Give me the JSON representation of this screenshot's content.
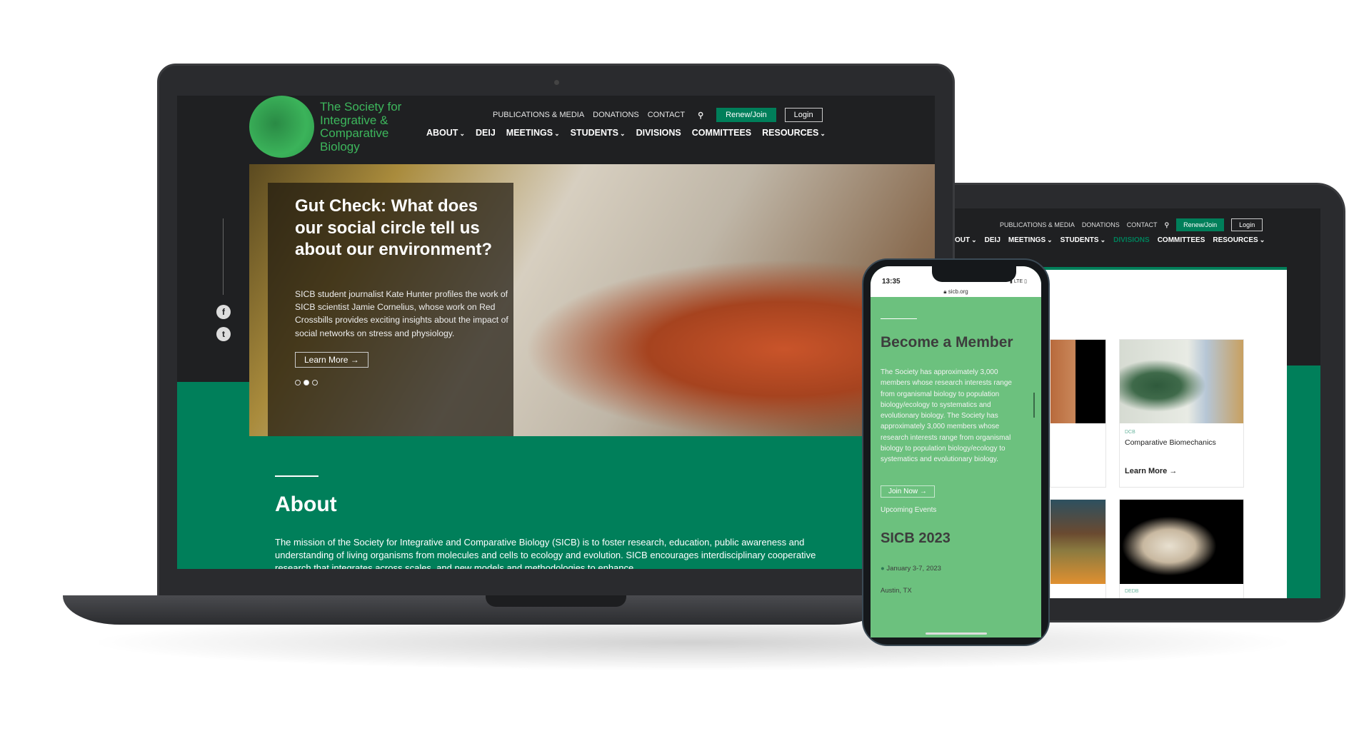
{
  "site": {
    "logo_text": "The Society for Integrative & Comparative Biology",
    "top_nav": [
      "PUBLICATIONS & MEDIA",
      "DONATIONS",
      "CONTACT"
    ],
    "search_icon": "search-icon",
    "renew_label": "Renew/Join",
    "login_label": "Login",
    "main_nav": [
      {
        "label": "ABOUT",
        "dropdown": true
      },
      {
        "label": "DEIJ",
        "dropdown": false
      },
      {
        "label": "MEETINGS",
        "dropdown": true
      },
      {
        "label": "STUDENTS",
        "dropdown": true
      },
      {
        "label": "DIVISIONS",
        "dropdown": false
      },
      {
        "label": "COMMITTEES",
        "dropdown": false
      },
      {
        "label": "RESOURCES",
        "dropdown": true
      }
    ],
    "colors": {
      "brand_green": "#007f5a",
      "logo_green": "#3db65c",
      "header_dark": "#1f2022",
      "mobile_green": "#6cc17e"
    }
  },
  "laptop": {
    "hero": {
      "title": "Gut Check: What does our social circle tell us about our environment?",
      "body": "SICB student journalist Kate Hunter profiles the work of SICB scientist Jamie Cornelius, whose work on Red Crossbills provides exciting insights about the impact of social networks on stress and physiology.",
      "button": "Learn More",
      "slide_count": 3,
      "active_slide": 2
    },
    "social": [
      "facebook-icon",
      "twitter-icon"
    ],
    "about": {
      "title": "About",
      "body": "The mission of the Society for Integrative and Comparative Biology (SICB) is to foster research, education, public awareness and understanding of living organisms from molecules and cells to ecology and evolution. SICB encourages interdisciplinary cooperative research that integrates across scales, and new models and methodologies to enhance"
    }
  },
  "tablet": {
    "nav_partial_first": "OUT",
    "active_nav": "DIVISIONS",
    "cards": [
      {
        "tag": "DCB",
        "title": "Comparative Biomechanics",
        "link": "Learn More"
      },
      {
        "tag": "DEDB"
      }
    ]
  },
  "phone": {
    "time": "13:35",
    "carrier": "LTE",
    "url": "sicb.org",
    "title": "Become a Member",
    "body": "The Society has approximately 3,000 members whose research interests range from organismal biology to population biology/ecology to systematics and evolutionary biology. The Society has approximately 3,000 members whose research interests range from organismal biology to population biology/ecology to systematics and evolutionary biology.",
    "join_label": "Join Now",
    "events_label": "Upcoming Events",
    "event_title": "SICB 2023",
    "event_date": "January 3-7, 2023",
    "event_location": "Austin, TX"
  }
}
